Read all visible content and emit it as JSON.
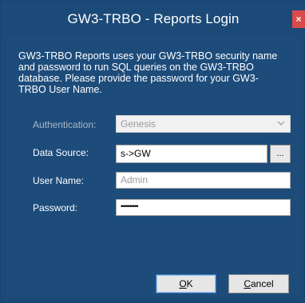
{
  "window": {
    "title": "GW3-TRBO - Reports Login",
    "close_label": "×"
  },
  "description": "GW3-TRBO Reports uses your GW3-TRBO security name and password to run SQL queries on the GW3-TRBO database.  Please provide the password for your GW3-TRBO User Name.",
  "form": {
    "authentication_label": "Authentication:",
    "authentication_value": "Genesis",
    "data_source_label": "Data Source:",
    "data_source_value": "s->GW",
    "browse_label": "...",
    "user_name_label": "User Name:",
    "user_name_value": "Admin",
    "password_label": "Password:",
    "password_mask": "••••••••••"
  },
  "buttons": {
    "ok_underlined": "O",
    "ok_rest": "K",
    "cancel_underlined": "C",
    "cancel_rest": "ancel"
  }
}
